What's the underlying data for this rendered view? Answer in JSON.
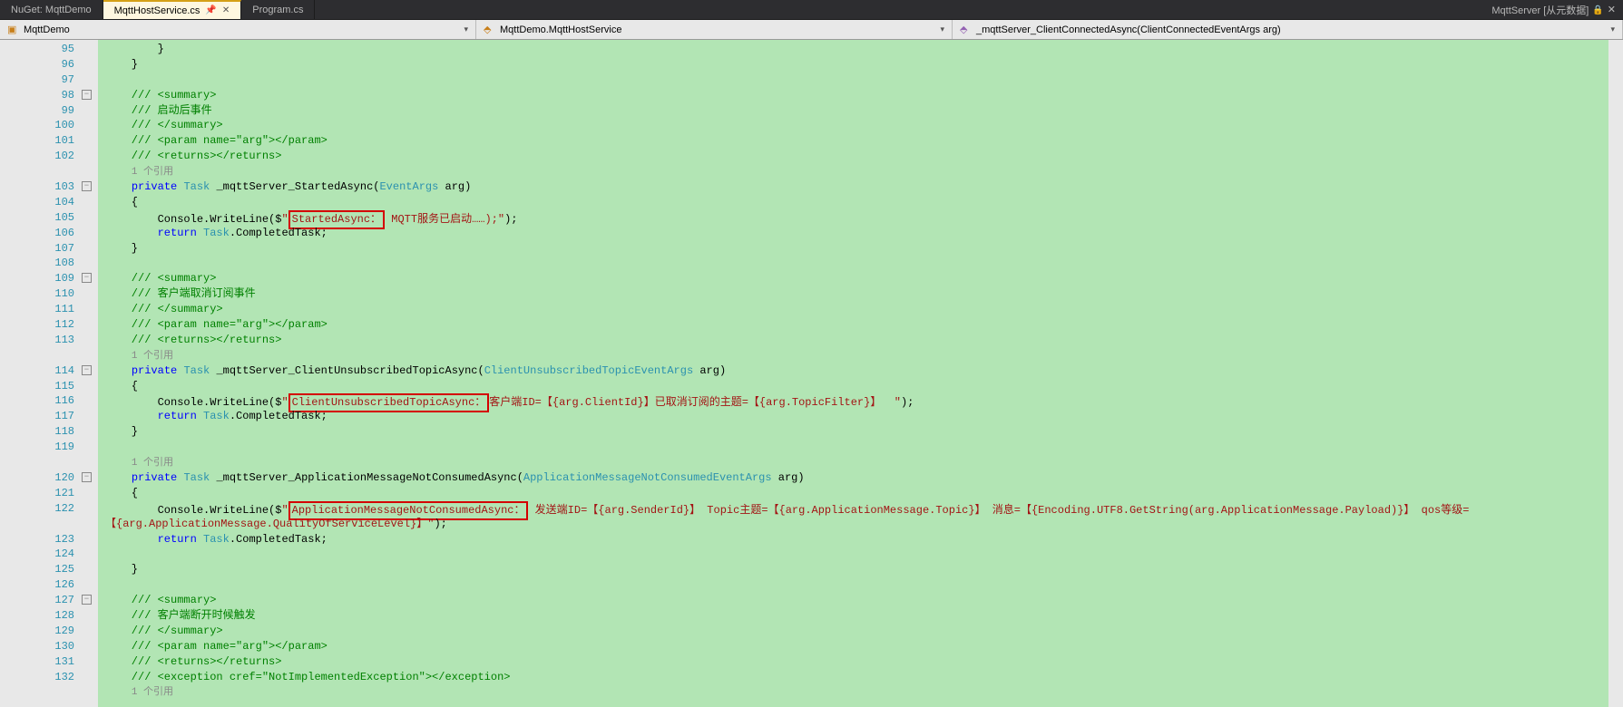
{
  "tabs": {
    "items": [
      {
        "label": "NuGet: MqttDemo",
        "active": false
      },
      {
        "label": "MqttHostService.cs",
        "active": true
      },
      {
        "label": "Program.cs",
        "active": false
      }
    ]
  },
  "status": {
    "right": "MqttServer [从元数据]"
  },
  "navbar": {
    "left": "MqttDemo",
    "mid": "MqttDemo.MqttHostService",
    "right": "_mqttServer_ClientConnectedAsync(ClientConnectedEventArgs arg)"
  },
  "lines": [
    {
      "n": "95",
      "code": "        }"
    },
    {
      "n": "96",
      "code": "    }"
    },
    {
      "n": "97",
      "code": ""
    },
    {
      "n": "98",
      "fold": "-",
      "code": "    /// <summary>"
    },
    {
      "n": "99",
      "code": "    /// 启动后事件"
    },
    {
      "n": "100",
      "code": "    /// </summary>"
    },
    {
      "n": "101",
      "code": "    /// <param name=\"arg\"></param>"
    },
    {
      "n": "102",
      "code": "    /// <returns></returns>"
    },
    {
      "n": "",
      "codelens": "1 个引用"
    },
    {
      "n": "103",
      "fold": "-",
      "code": "    private Task _mqttServer_StartedAsync(EventArgs arg)"
    },
    {
      "n": "104",
      "code": "    {"
    },
    {
      "n": "105",
      "code_started": true
    },
    {
      "n": "106",
      "code": "        return Task.CompletedTask;"
    },
    {
      "n": "107",
      "code": "    }"
    },
    {
      "n": "108",
      "code": ""
    },
    {
      "n": "109",
      "fold": "-",
      "code": "    /// <summary>"
    },
    {
      "n": "110",
      "code": "    /// 客户端取消订阅事件"
    },
    {
      "n": "111",
      "code": "    /// </summary>"
    },
    {
      "n": "112",
      "code": "    /// <param name=\"arg\"></param>"
    },
    {
      "n": "113",
      "code": "    /// <returns></returns>"
    },
    {
      "n": "",
      "codelens": "1 个引用"
    },
    {
      "n": "114",
      "fold": "-",
      "code": "    private Task _mqttServer_ClientUnsubscribedTopicAsync(ClientUnsubscribedTopicEventArgs arg)"
    },
    {
      "n": "115",
      "code": "    {"
    },
    {
      "n": "116",
      "code_unsub": true
    },
    {
      "n": "117",
      "code": "        return Task.CompletedTask;"
    },
    {
      "n": "118",
      "code": "    }"
    },
    {
      "n": "119",
      "code": ""
    },
    {
      "n": "",
      "codelens": "1 个引用"
    },
    {
      "n": "120",
      "fold": "-",
      "code": "    private Task _mqttServer_ApplicationMessageNotConsumedAsync(ApplicationMessageNotConsumedEventArgs arg)"
    },
    {
      "n": "121",
      "code": "    {"
    },
    {
      "n": "122",
      "code_app": true
    },
    {
      "n": "",
      "code": "【{arg.ApplicationMessage.QualityOfServiceLevel}】\");"
    },
    {
      "n": "123",
      "code": "        return Task.CompletedTask;"
    },
    {
      "n": "124",
      "code": ""
    },
    {
      "n": "125",
      "code": "    }"
    },
    {
      "n": "126",
      "code": ""
    },
    {
      "n": "127",
      "fold": "-",
      "code": "    /// <summary>"
    },
    {
      "n": "128",
      "code": "    /// 客户端断开时候触发"
    },
    {
      "n": "129",
      "code": "    /// </summary>"
    },
    {
      "n": "130",
      "code": "    /// <param name=\"arg\"></param>"
    },
    {
      "n": "131",
      "code": "    /// <returns></returns>"
    },
    {
      "n": "132",
      "code": "    /// <exception cref=\"NotImplementedException\"></exception>"
    },
    {
      "n": "",
      "codelens": "1 个引用"
    }
  ],
  "highlighted_strings": {
    "started_prefix": "        Console.WriteLine($\"",
    "started_box": "StartedAsync：",
    "started_suffix": " MQTT服务已启动……\");",
    "unsub_prefix": "        Console.WriteLine($\"",
    "unsub_box": "ClientUnsubscribedTopicAsync：",
    "unsub_suffix": "客户端ID=【{arg.ClientId}】已取消订阅的主题=【{arg.TopicFilter}】  \");",
    "app_prefix": "        Console.WriteLine($\"",
    "app_box": "ApplicationMessageNotConsumedAsync：",
    "app_suffix": " 发送端ID=【{arg.SenderId}】 Topic主题=【{arg.ApplicationMessage.Topic}】 消息=【{Encoding.UTF8.GetString(arg.ApplicationMessage.Payload)}】 qos等级=",
    "app_wrap": "【{arg.ApplicationMessage.QualityOfServiceLevel}】\");"
  }
}
